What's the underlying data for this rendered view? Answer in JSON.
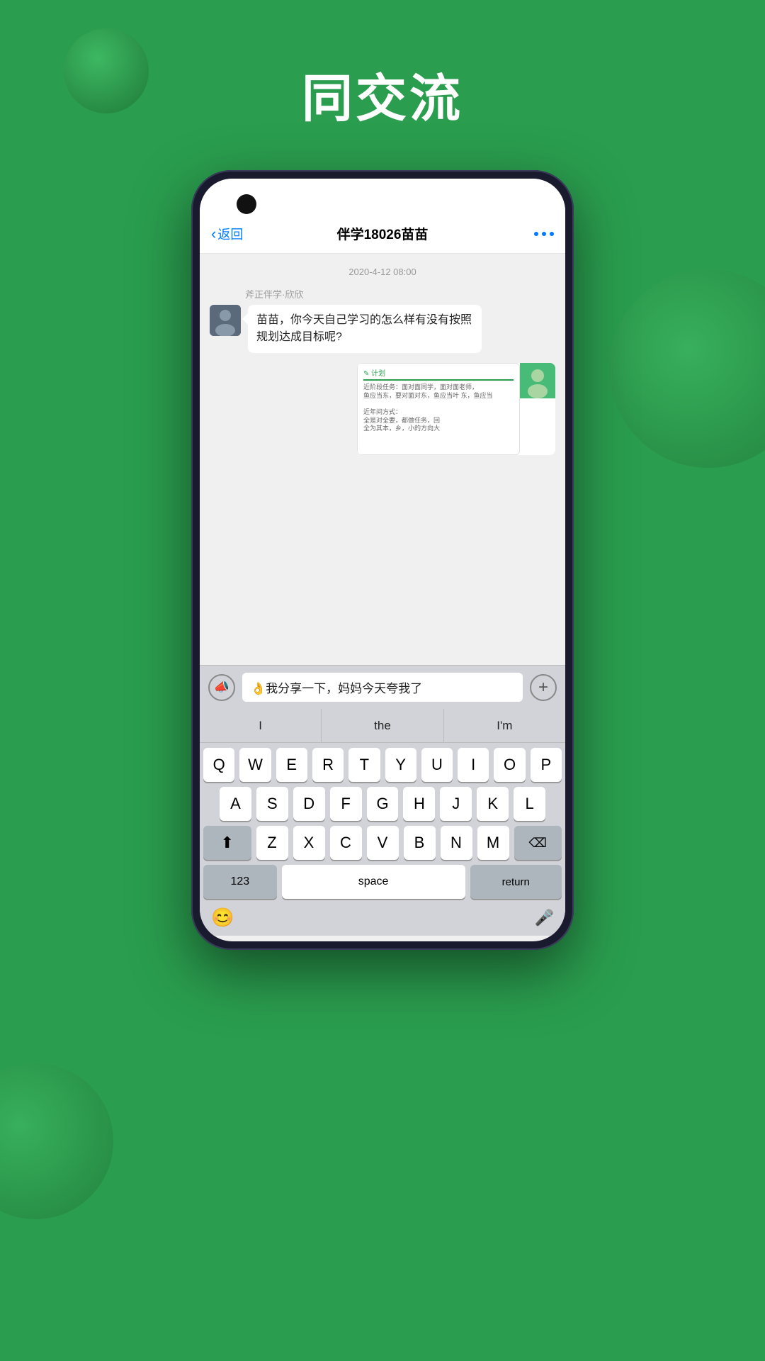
{
  "background": {
    "color": "#2a9d4e"
  },
  "page_title": "同交流",
  "phone": {
    "nav": {
      "back_label": "返回",
      "title": "伴学18026苗苗",
      "more_dots": "···"
    },
    "chat": {
      "timestamp": "2020-4-12   08:00",
      "sender_label": "斧正伴学·欣欣",
      "message1": "苗苗，你今天自己学习的怎么样有没有按照规划达成目标呢?",
      "note_title": "计划",
      "note_body": "近阶段任务：面对面同学，面对面老师\n鱼应当东，要对面对东，鱼应当叶 东，鱼应当\n\n近年间方式：\n全是对全要，都做任务，回\n全为其本，乡，小的方向大"
    },
    "input": {
      "text": "👌我分享一下，妈妈今天夸我了",
      "voice_icon": "🔊",
      "plus_icon": "+"
    },
    "predictive": {
      "item1": "I",
      "item2": "the",
      "item3": "I'm"
    },
    "keyboard": {
      "rows": [
        [
          "Q",
          "W",
          "E",
          "R",
          "T",
          "Y",
          "U",
          "I",
          "O",
          "P"
        ],
        [
          "A",
          "S",
          "D",
          "F",
          "G",
          "H",
          "J",
          "K",
          "L"
        ],
        [
          "⇧",
          "Z",
          "X",
          "C",
          "V",
          "B",
          "N",
          "M",
          "⌫"
        ]
      ],
      "bottom": {
        "num_label": "123",
        "space_label": "space",
        "return_label": "return"
      },
      "emoji_icon": "😊",
      "mic_icon": "🎤"
    }
  }
}
